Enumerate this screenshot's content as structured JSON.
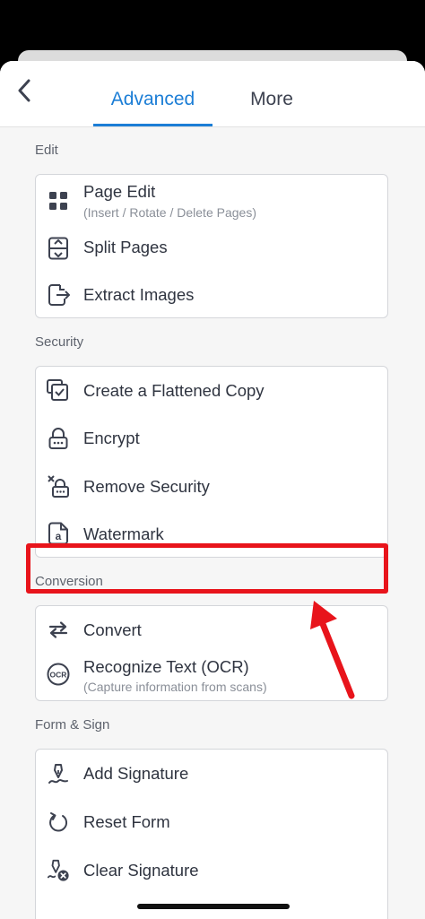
{
  "tabs": {
    "advanced": "Advanced",
    "more": "More"
  },
  "sections": {
    "edit": {
      "label": "Edit",
      "items": [
        {
          "label": "Page Edit",
          "sub": "(Insert / Rotate / Delete Pages)",
          "icon": "grid-icon"
        },
        {
          "label": "Split Pages",
          "icon": "split-pages-icon"
        },
        {
          "label": "Extract Images",
          "icon": "extract-icon"
        }
      ]
    },
    "security": {
      "label": "Security",
      "items": [
        {
          "label": "Create a Flattened Copy",
          "icon": "flatten-icon"
        },
        {
          "label": "Encrypt",
          "icon": "lock-icon"
        },
        {
          "label": "Remove Security",
          "icon": "unlock-icon"
        },
        {
          "label": "Watermark",
          "icon": "watermark-icon"
        }
      ]
    },
    "conversion": {
      "label": "Conversion",
      "items": [
        {
          "label": "Convert",
          "icon": "convert-icon"
        },
        {
          "label": "Recognize Text (OCR)",
          "sub": "(Capture information from scans)",
          "icon": "ocr-icon"
        }
      ]
    },
    "form_sign": {
      "label": "Form & Sign",
      "items": [
        {
          "label": "Add Signature",
          "icon": "signature-icon"
        },
        {
          "label": "Reset Form",
          "icon": "reset-icon"
        },
        {
          "label": "Clear Signature",
          "icon": "clear-signature-icon"
        }
      ]
    }
  },
  "colors": {
    "accent": "#1c7ed6",
    "highlight": "#e8141b",
    "text": "#2f3440",
    "muted": "#8a8f98"
  },
  "ocr_icon_text": "OCR",
  "watermark_icon_text": "a"
}
